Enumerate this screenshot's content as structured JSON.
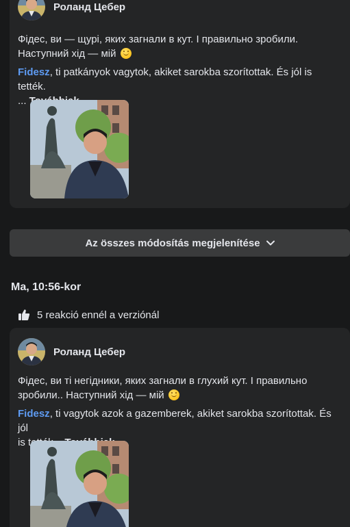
{
  "posts": [
    {
      "author": "Роланд Цебер",
      "text_uk_1": "Фідес, ви — щурі, яких загнали в кут. І правильно зробили.",
      "text_uk_2": "Наступний хід — мій",
      "link": "Fidesz",
      "text_hu_1": ", ti patkányok vagytok, akiket sarokba szorítottak. És jól is tették.",
      "text_hu_2": "... ",
      "more_label": "Továbbiak"
    },
    {
      "author": "Роланд Цебер",
      "text_uk_1": "Фідес, ви ті негідники, яких загнали в глухий кут. І правильно",
      "text_uk_2": "зробили.. Наступний хід — мій",
      "link": "Fidesz",
      "text_hu_1": ", ti vagytok azok a gazemberek, akiket sarokba szorítottak. És jól",
      "text_hu_2": "is tették... ",
      "more_label": "Továbbiak"
    }
  ],
  "show_all_label": "Az összes módosítás megjelenítése",
  "timestamp": "Ma, 10:56-kor",
  "reactions_label": "5 reakció ennél a verziónál",
  "icons": {
    "emoji": "winking-smile-icon",
    "chevron": "chevron-down-icon",
    "reaction": "thumbs-up-icon"
  },
  "colors": {
    "background": "#18191a",
    "card": "#242526",
    "button": "#3a3b3c",
    "link": "#5e9bf2",
    "text": "#e4e6eb"
  }
}
